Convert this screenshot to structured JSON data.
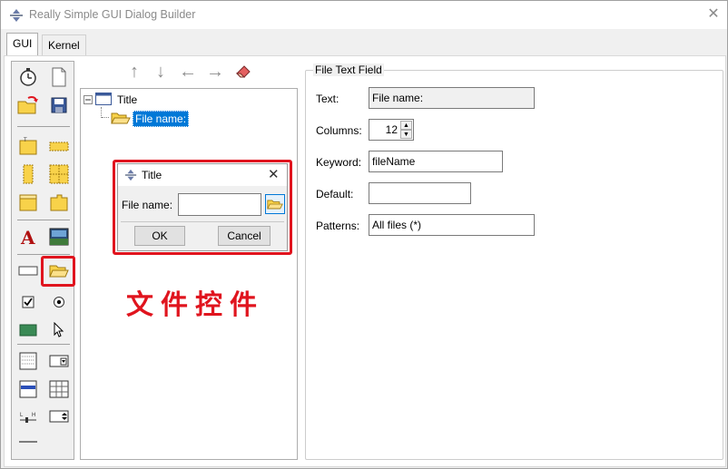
{
  "window": {
    "title": "Really Simple GUI Dialog Builder"
  },
  "tabs": [
    {
      "label": "GUI",
      "active": true
    },
    {
      "label": "Kernel",
      "active": false
    }
  ],
  "tree": {
    "root_label": "Title",
    "child_label": "File name:"
  },
  "preview_dialog": {
    "title": "Title",
    "field_label": "File name:",
    "ok_label": "OK",
    "cancel_label": "Cancel"
  },
  "annotation_text": "文件控件",
  "properties": {
    "section_title": "File Text Field",
    "text_label": "Text:",
    "text_value": "File name:",
    "columns_label": "Columns:",
    "columns_value": "12",
    "keyword_label": "Keyword:",
    "keyword_value": "fileName",
    "default_label": "Default:",
    "default_value": "",
    "patterns_label": "Patterns:",
    "patterns_value": "All files (*)"
  },
  "colors": {
    "highlight_red": "#e0141e",
    "selection_blue": "#0078d7",
    "folder_yellow": "#f8d24a"
  }
}
